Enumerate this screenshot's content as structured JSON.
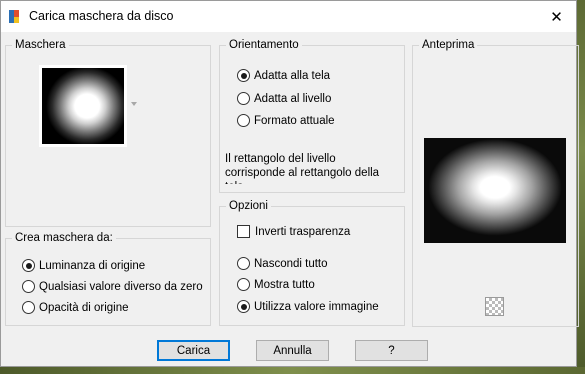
{
  "window": {
    "title": "Carica maschera da disco",
    "close_glyph": "✕",
    "app_icon": "paintshop-pro-icon"
  },
  "maschera": {
    "label": "Maschera"
  },
  "orientamento": {
    "label": "Orientamento",
    "options": [
      "Adatta alla tela",
      "Adatta al livello",
      "Formato attuale"
    ],
    "selected": 0,
    "info": "Il rettangolo del livello corrisponde al rettangolo della tela"
  },
  "crea": {
    "label": "Crea maschera da:",
    "options": [
      "Luminanza di origine",
      "Qualsiasi valore diverso da zero",
      "Opacità di origine"
    ],
    "selected": 0
  },
  "opzioni": {
    "label": "Opzioni",
    "invert_label": "Inverti trasparenza",
    "invert_checked": false,
    "options": [
      "Nascondi tutto",
      "Mostra tutto",
      "Utilizza valore immagine"
    ],
    "selected": 2
  },
  "anteprima": {
    "label": "Anteprima"
  },
  "buttons": {
    "load": "Carica",
    "cancel": "Annulla",
    "help": "?"
  },
  "colors": {
    "dialog_bg": "#f0f0f0",
    "default_button_border": "#0078d7"
  }
}
